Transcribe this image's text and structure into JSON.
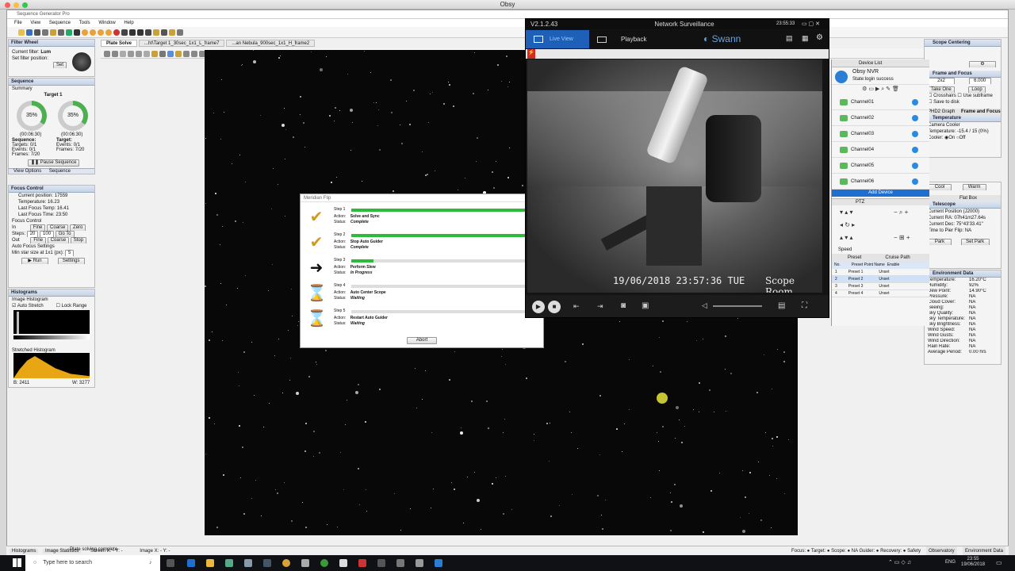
{
  "mac": {
    "title": "Obsy"
  },
  "sgp": {
    "title": "Sequence Generator Pro",
    "menus": [
      "File",
      "View",
      "Sequence",
      "Tools",
      "Window",
      "Help"
    ]
  },
  "tabs": [
    "Plate Solve",
    "...ht\\Target 1_30sec_1x1_L_frame7",
    "...an Nebula_900sec_1x1_H_frame2"
  ],
  "filter": {
    "header": "Filter Wheel",
    "current_label": "Current filter:",
    "current": "Lum",
    "set_label": "Set filter position:",
    "set_btn": "Set"
  },
  "sequence": {
    "header": "Sequence",
    "summary": "Summary",
    "target_name": "Target 1",
    "pct_left": "35%",
    "pct_right": "35%",
    "time_left": "(00:06:30)",
    "time_right": "(00:06:30)",
    "seq_label": "Sequence:",
    "targets": "Targets:",
    "targets_v": "0/1",
    "events": "Events:",
    "events_v": "0/1",
    "frames": "Frames:",
    "frames_v": "7/20",
    "tgt_label": "Target:",
    "t_events": "Events:",
    "t_events_v": "0/1",
    "t_frames": "Frames:",
    "t_frames_v": "7/20",
    "pause": "Pause Sequence",
    "view_options": "View Options",
    "sequence_tab": "Sequence"
  },
  "focus": {
    "header": "Focus Control",
    "pos": "Current position:",
    "pos_v": "17559",
    "temp": "Temperature:",
    "temp_v": "16.23",
    "lft": "Last Focus Temp:",
    "lft_v": "16.41",
    "lftime": "Last Focus Time:",
    "lftime_v": "23:50",
    "fc": "Focus Control",
    "in": "In",
    "fine": "Fine",
    "coarse": "Coarse",
    "zero": "Zero",
    "steps": "Steps:",
    "s1": "20",
    "s2": "100",
    "goto": "Go To",
    "out": "Out",
    "fine2": "Fine",
    "coarse2": "Coarse",
    "stop": "Stop",
    "af": "Auto Focus Settings",
    "min": "Min star size at 1x1 (px):",
    "min_v": "5",
    "run": "Run",
    "settings": "Settings"
  },
  "hist": {
    "header": "Histograms",
    "image": "Image Histogram",
    "auto": "Auto Stretch",
    "lock": "Lock Range",
    "stretched": "Stretched Histogram",
    "b": "B: 2411",
    "w": "W: 3277"
  },
  "meridian": {
    "title": "Meridian Flip",
    "steps": [
      {
        "n": "Step 1",
        "action": "Solve and Sync",
        "status": "Complete",
        "pct": 100,
        "icon": "check"
      },
      {
        "n": "Step 2",
        "action": "Stop Auto Guider",
        "status": "Complete",
        "pct": 100,
        "icon": "check"
      },
      {
        "n": "Step 3",
        "action": "Perform Slew",
        "status": "In Progress",
        "pct": 12,
        "icon": "arrow"
      },
      {
        "n": "Step 4",
        "action": "Auto Center Scope",
        "status": "Waiting",
        "pct": 0,
        "icon": "hourglass"
      },
      {
        "n": "Step 5",
        "action": "Restart Auto Guider",
        "status": "Waiting",
        "pct": 0,
        "icon": "hourglass"
      }
    ],
    "action_lbl": "Action:",
    "status_lbl": "Status:",
    "abort": "Abort"
  },
  "nvr": {
    "version": "V2.1.2.43",
    "title": "Network Surveillance",
    "time": "23:55:33",
    "live": "Live View",
    "playback": "Playback",
    "brand": "Swann",
    "osd_time": "19/06/2018 23:57:36 TUE",
    "osd_cam": "Scope Room",
    "device_list": "Device List",
    "nvr_name": "Obsy NVR",
    "state": "State:login success",
    "channels": [
      "Channel01",
      "Channel02",
      "Channel03",
      "Channel04",
      "Channel05",
      "Channel06"
    ],
    "add": "Add Device",
    "ptz": "PTZ",
    "speed": "Speed",
    "preset": "Preset",
    "cruise": "Cruise Path",
    "ph_no": "No.",
    "ph_name": "Preset Point Name",
    "ph_en": "Enable",
    "presets": [
      {
        "n": "1",
        "name": "Preset 1",
        "s": "Unset"
      },
      {
        "n": "2",
        "name": "Preset 2",
        "s": "Unset"
      },
      {
        "n": "3",
        "name": "Preset 3",
        "s": "Unset"
      },
      {
        "n": "4",
        "name": "Preset 4",
        "s": "Unset"
      }
    ]
  },
  "right": {
    "centering": "Scope Centering",
    "frame_focus": "Frame and Focus",
    "binning": "2x2",
    "exposure": "6.000",
    "crosshairs": "Crosshairs",
    "subframe": "Use subframe",
    "save": "Save to disk",
    "take": "Take One",
    "loop": "Loop",
    "phd": "PHD2 Graph",
    "ff_tab": "Frame and Focus",
    "temp_h": "Temperature",
    "cooler": "Camera Cooler",
    "ctemp": "Temperature: -15.4 / 15 (0%)",
    "cooler_lbl": "Cooler:",
    "on": "On",
    "off": "Off",
    "cool": "Cool",
    "warm": "Warm",
    "flatbox": "Flat Box",
    "telescope": "Telescope",
    "cur_pos": "Current Position (J2000)",
    "ra": "Current RA:",
    "ra_v": "07h41m27.64s",
    "dec": "Current Dec:",
    "dec_v": "75°43'33.41\"",
    "flip": "Time to Pier Flip:",
    "flip_v": "NA",
    "park": "Park",
    "setpark": "Set Park",
    "env": "Environment Data",
    "env_rows": [
      [
        "Temperature:",
        "16.20°C"
      ],
      [
        "Humidity:",
        "92%"
      ],
      [
        "Dew Point:",
        "14.90°C"
      ],
      [
        "Pressure:",
        "NA"
      ],
      [
        "Cloud Cover:",
        "NA"
      ],
      [
        "Seeing:",
        "NA"
      ],
      [
        "Sky Quality:",
        "NA"
      ],
      [
        "Sky Temperature:",
        "NA"
      ],
      [
        "Sky Brightness:",
        "NA"
      ],
      [
        "Wind Speed:",
        "NA"
      ],
      [
        "Wind Gusts:",
        "NA"
      ],
      [
        "Wind Direction:",
        "NA"
      ],
      [
        "Rain Rate:",
        "NA"
      ],
      [
        "Average Period:",
        "0.00 hrs"
      ]
    ]
  },
  "status": {
    "hist_tab": "Histograms",
    "stats_tab": "Image Statistics",
    "screen": "Screen X: - Y: -",
    "image": "Image X: - Y: -",
    "msg": "Plate solving complete",
    "obs": "Observatory",
    "env": "Environment Data",
    "right": "Focus: ●  Target: ●  Scope: ● NA  Guider: ●  Recovery: ●  Safety"
  },
  "taskbar": {
    "search": "Type here to search",
    "time": "23:55",
    "date": "19/06/2018",
    "lang": "ENG"
  }
}
